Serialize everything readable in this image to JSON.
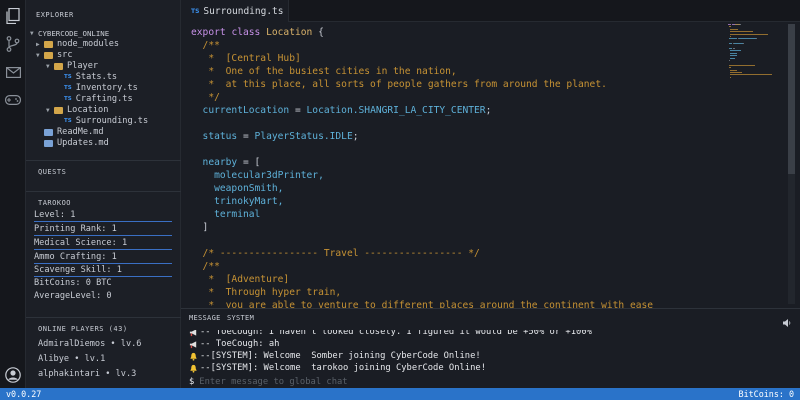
{
  "app": {
    "title": "CyberCode Online"
  },
  "sidebar": {
    "explorer_title": "EXPLORER",
    "project_name": "CYBERCODE_ONLINE",
    "tree": [
      {
        "label": "node_modules",
        "type": "folder",
        "indent": 1
      },
      {
        "label": "src",
        "type": "folder",
        "indent": 1
      },
      {
        "label": "Player",
        "type": "folder",
        "indent": 2
      },
      {
        "label": "Stats.ts",
        "type": "ts",
        "indent": 3
      },
      {
        "label": "Inventory.ts",
        "type": "ts",
        "indent": 3
      },
      {
        "label": "Crafting.ts",
        "type": "ts",
        "indent": 3
      },
      {
        "label": "Location",
        "type": "folder",
        "indent": 2
      },
      {
        "label": "Surrounding.ts",
        "type": "ts",
        "indent": 3
      },
      {
        "label": "ReadMe.md",
        "type": "md",
        "indent": 1
      },
      {
        "label": "Updates.md",
        "type": "md",
        "indent": 1
      }
    ],
    "quests_title": "QUESTS",
    "player_title": "TAROKOO",
    "stats": [
      {
        "label": "Level: 1"
      },
      {
        "label": "Printing Rank: 1"
      },
      {
        "label": "Medical Science: 1"
      },
      {
        "label": "Ammo Crafting: 1"
      },
      {
        "label": "Scavenge Skill: 1"
      },
      {
        "label": "BitCoins: 0 BTC"
      },
      {
        "label": "AverageLevel: 0"
      }
    ],
    "online_title": "ONLINE PLAYERS (43)",
    "online_players": [
      "AdmiralDiemos • lv.6",
      "Alibye • lv.1",
      "alphakintari • lv.3"
    ]
  },
  "tabs": [
    {
      "label": "Surrounding.ts",
      "icon": "TS"
    }
  ],
  "editor": {
    "lines": [
      {
        "segments": [
          {
            "t": "export ",
            "c": "kw"
          },
          {
            "t": "class ",
            "c": "kw"
          },
          {
            "t": "Location",
            "c": "cls"
          },
          {
            "t": " {",
            "c": "op"
          }
        ]
      },
      {
        "segments": [
          {
            "t": "  /**",
            "c": "cm"
          }
        ]
      },
      {
        "segments": [
          {
            "t": "   *  [Central Hub]",
            "c": "cm"
          }
        ]
      },
      {
        "segments": [
          {
            "t": "   *  One of the busiest cities in the nation,",
            "c": "cm"
          }
        ]
      },
      {
        "segments": [
          {
            "t": "   *  at this place, all sorts of people gathers from around the planet.",
            "c": "cm"
          }
        ]
      },
      {
        "segments": [
          {
            "t": "   */",
            "c": "cm"
          }
        ]
      },
      {
        "segments": [
          {
            "t": "  currentLocation",
            "c": "prop"
          },
          {
            "t": " = ",
            "c": "op"
          },
          {
            "t": "Location.SHANGRI_LA_CITY_CENTER",
            "c": "val"
          },
          {
            "t": ";",
            "c": "op"
          }
        ]
      },
      {
        "segments": []
      },
      {
        "segments": [
          {
            "t": "  status",
            "c": "prop"
          },
          {
            "t": " = ",
            "c": "op"
          },
          {
            "t": "PlayerStatus.IDLE",
            "c": "val"
          },
          {
            "t": ";",
            "c": "op"
          }
        ]
      },
      {
        "segments": []
      },
      {
        "segments": [
          {
            "t": "  nearby",
            "c": "prop"
          },
          {
            "t": " = [",
            "c": "op"
          }
        ]
      },
      {
        "segments": [
          {
            "t": "    molecular3dPrinter,",
            "c": "val"
          }
        ]
      },
      {
        "segments": [
          {
            "t": "    weaponSmith,",
            "c": "val"
          }
        ]
      },
      {
        "segments": [
          {
            "t": "    trinokyMart,",
            "c": "val"
          }
        ]
      },
      {
        "segments": [
          {
            "t": "    terminal",
            "c": "val"
          }
        ]
      },
      {
        "segments": [
          {
            "t": "  ]",
            "c": "op"
          }
        ]
      },
      {
        "segments": []
      },
      {
        "segments": [
          {
            "t": "  /* ----------------- Travel ----------------- */",
            "c": "cm"
          }
        ]
      },
      {
        "segments": [
          {
            "t": "  /**",
            "c": "cm"
          }
        ]
      },
      {
        "segments": [
          {
            "t": "   *  [Adventure]",
            "c": "cm"
          }
        ]
      },
      {
        "segments": [
          {
            "t": "   *  Through hyper train,",
            "c": "cm"
          }
        ]
      },
      {
        "segments": [
          {
            "t": "   *  you are able to venture to different places around the continent with ease",
            "c": "cm"
          }
        ]
      },
      {
        "segments": [
          {
            "t": "   */",
            "c": "cm"
          }
        ]
      }
    ]
  },
  "panel": {
    "tabs": [
      "MESSAGE",
      "SYSTEM"
    ],
    "messages": [
      {
        "icon": "megaphone-icon",
        "text": "-- ToeCough: I haven't looked closely. I figured it would be +50% or +100%"
      },
      {
        "icon": "megaphone-icon",
        "text": "-- ToeCough: ah"
      },
      {
        "icon": "bell-icon",
        "text": "--[SYSTEM]: Welcome  Somber joining CyberCode Online!"
      },
      {
        "icon": "bell-icon",
        "text": "--[SYSTEM]: Welcome  tarokoo joining CyberCode Online!"
      }
    ],
    "prompt": "$",
    "input_placeholder": "Enter message to global chat"
  },
  "statusbar": {
    "version": "v0.0.27",
    "bitcoins": "BitCoins: 0"
  },
  "colors": {
    "accent": "#2a73c9",
    "background": "#1a1d24",
    "comment": "#c69234",
    "keyword": "#c791e8",
    "property": "#5eb1d9"
  }
}
